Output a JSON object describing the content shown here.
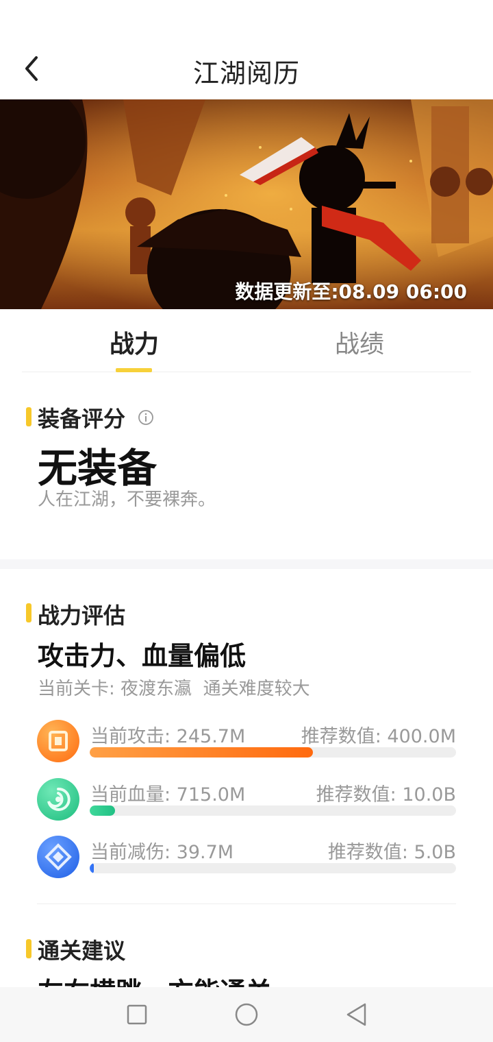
{
  "header": {
    "title": "江湖阅历",
    "back_icon": "chevron-left-icon"
  },
  "banner": {
    "update_label": "数据更新至:",
    "update_time": "08.09 06:00"
  },
  "tabs": [
    {
      "label": "战力",
      "active": true
    },
    {
      "label": "战绩",
      "active": false
    }
  ],
  "equipment": {
    "title": "装备评分",
    "info_icon": "info-icon",
    "value": "无装备",
    "note": "人在江湖，不要裸奔。"
  },
  "power": {
    "title": "战力评估",
    "verdict": "攻击力、血量偏低",
    "stage_label": "当前关卡: 夜渡东瀛",
    "difficulty": "通关难度较大",
    "stats": [
      {
        "icon": "attack-icon",
        "label": "当前攻击: 245.7M",
        "recommend": "推荐数值: 400.0M",
        "fill_fraction": 0.61,
        "color_from": "#ffa045",
        "color_to": "#ff6a0f",
        "icon_bg": "#ff7a1a"
      },
      {
        "icon": "health-icon",
        "label": "当前血量: 715.0M",
        "recommend": "推荐数值: 10.0B",
        "fill_fraction": 0.07,
        "color_from": "#3fd89a",
        "color_to": "#21c084",
        "icon_bg": "#2fc98a"
      },
      {
        "icon": "defense-icon",
        "label": "当前减伤: 39.7M",
        "recommend": "推荐数值: 5.0B",
        "fill_fraction": 0.008,
        "color_from": "#3a7bff",
        "color_to": "#2f6ef0",
        "icon_bg": "#2f72f5"
      }
    ]
  },
  "advice": {
    "title": "通关建议",
    "text": "左右横跳，方能通关"
  },
  "navbar": {
    "recents_icon": "square-icon",
    "home_icon": "circle-icon",
    "back_icon": "triangle-back-icon"
  }
}
